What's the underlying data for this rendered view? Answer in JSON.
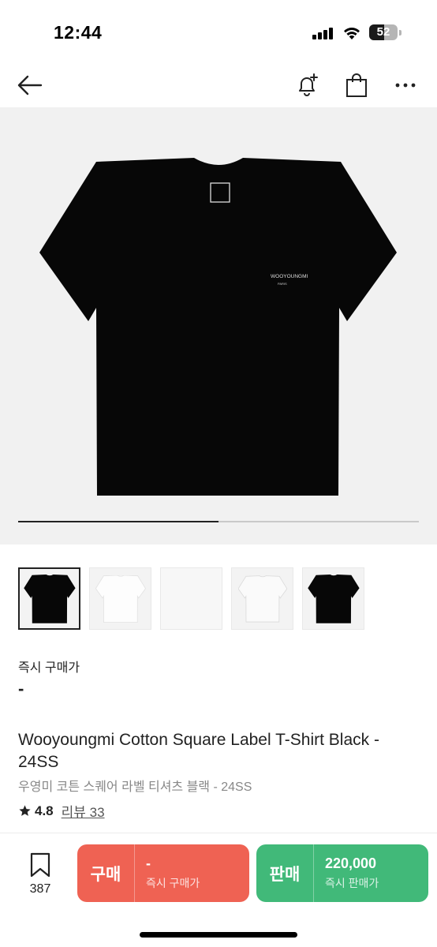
{
  "status_bar": {
    "time": "12:44",
    "battery_level": "52",
    "battery_fraction": 0.52,
    "icons": [
      "cellular-signal-icon",
      "wifi-icon",
      "battery-icon"
    ]
  },
  "header": {
    "icons": [
      "back-arrow-icon",
      "bell-plus-icon",
      "shopping-bag-icon",
      "more-icon"
    ]
  },
  "hero": {
    "product_image": "black-tshirt",
    "shirt_logo": "WOOYOUNGMI",
    "shirt_logo_sub": "PARIS",
    "carousel_progress": 0.5
  },
  "thumbnails": [
    {
      "name": "black-tshirt-front",
      "selected": true
    },
    {
      "name": "white-tshirt-front",
      "selected": false
    },
    {
      "name": "blank-white",
      "selected": false
    },
    {
      "name": "white-tshirt-worn",
      "selected": false
    },
    {
      "name": "black-tshirt-front-2",
      "selected": false
    }
  ],
  "price": {
    "label": "즉시 구매가",
    "value": "-"
  },
  "product": {
    "title_en": "Wooyoungmi Cotton Square Label T-Shirt Black - 24SS",
    "title_ko": "우영미 코튼 스퀘어 라벨 티셔츠 블랙 - 24SS",
    "rating": "4.8",
    "review_label": "리뷰 33"
  },
  "bottom_bar": {
    "bookmark_count": "387",
    "buy": {
      "label": "구매",
      "price": "-",
      "sub": "즉시 구매가"
    },
    "sell": {
      "label": "판매",
      "price": "220,000",
      "sub": "즉시 판매가"
    }
  },
  "colors": {
    "buy": "#ef6253",
    "sell": "#41b979",
    "hero_bg": "#f1f1f1"
  }
}
